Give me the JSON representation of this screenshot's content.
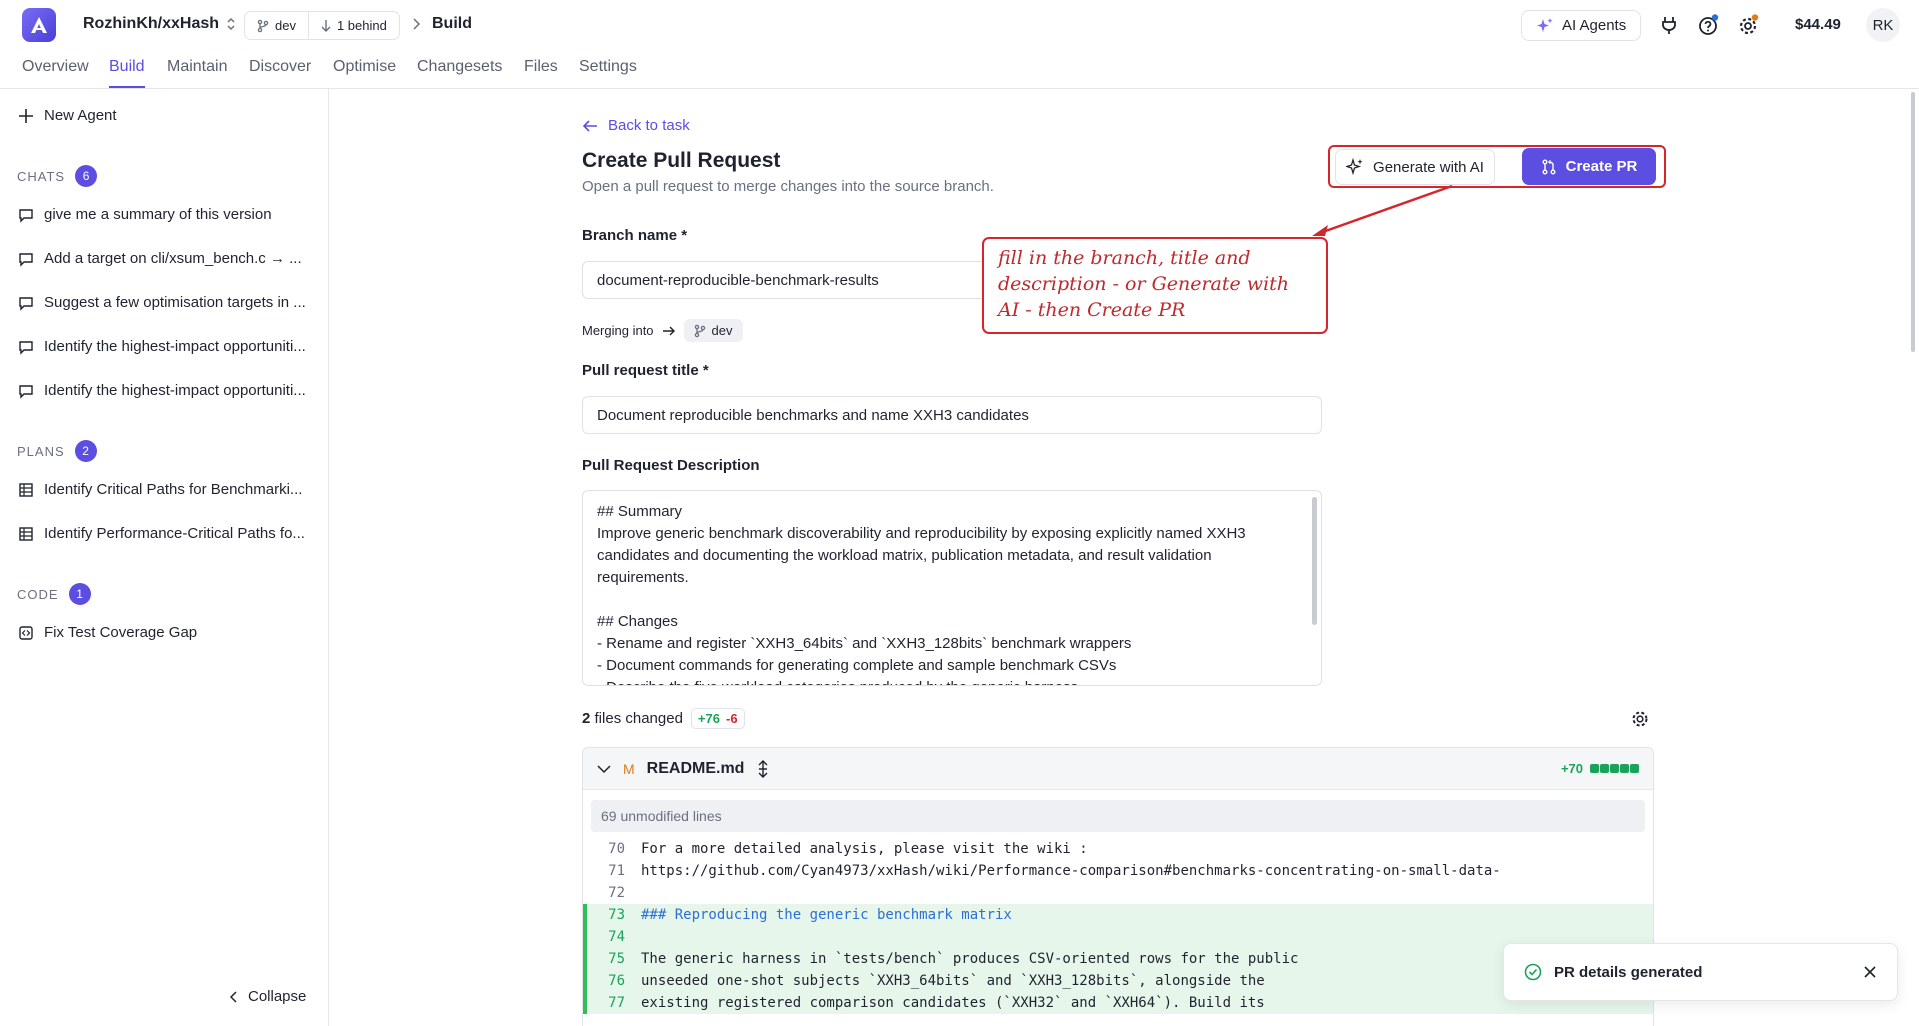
{
  "app": {
    "repo": "RozhinKh/xxHash",
    "branch": "dev",
    "behind": "1 behind",
    "crumb": "Build"
  },
  "top": {
    "ai_agents": "AI Agents",
    "balance": "$44.49",
    "avatar": "RK"
  },
  "nav": {
    "tabs": [
      "Overview",
      "Build",
      "Maintain",
      "Discover",
      "Optimise",
      "Changesets",
      "Files",
      "Settings"
    ],
    "active": "Build"
  },
  "sidebar": {
    "new_agent": "New Agent",
    "chats": {
      "label": "CHATS",
      "count": "6",
      "items": [
        "give me a summary of this version",
        "Add a target on cli/xsum_bench.c → ...",
        "Suggest a few optimisation targets in ...",
        "Identify the highest-impact opportuniti...",
        "Identify the highest-impact opportuniti..."
      ]
    },
    "plans": {
      "label": "PLANS",
      "count": "2",
      "items": [
        "Identify Critical Paths for Benchmarki...",
        "Identify Performance-Critical Paths fo..."
      ]
    },
    "code": {
      "label": "CODE",
      "count": "1",
      "items": [
        "Fix Test Coverage Gap"
      ]
    },
    "collapse": "Collapse"
  },
  "main": {
    "back": "Back to task",
    "title": "Create Pull Request",
    "subtitle": "Open a pull request to merge changes into the source branch.",
    "generate": "Generate with AI",
    "create": "Create PR",
    "branch_label": "Branch name *",
    "branch_value": "document-reproducible-benchmark-results",
    "merging_into": "Merging into",
    "merge_branch": "dev",
    "title_label": "Pull request title *",
    "title_value": "Document reproducible benchmarks and name XXH3 candidates",
    "desc_label": "Pull Request Description",
    "desc_lines": [
      "## Summary",
      "Improve generic benchmark discoverability and reproducibility by exposing explicitly named XXH3",
      "candidates and documenting the workload matrix, publication metadata, and result validation",
      "requirements.",
      "",
      "## Changes",
      "- Rename and register `XXH3_64bits` and `XXH3_128bits` benchmark wrappers",
      "- Document commands for generating complete and sample benchmark CSVs",
      "- Describe the five workload categories produced by the generic harness"
    ],
    "note_lines": [
      "fill in the branch, title and",
      "description - or Generate with",
      "AI - then Create PR"
    ],
    "files_count": "2",
    "files_text": "files changed",
    "additions": "+76",
    "deletions": "-6",
    "diff": {
      "status": "M",
      "file": "README.md",
      "plus": "+70",
      "unmodified": "69 unmodified lines",
      "lines": [
        {
          "no": "70",
          "text": "For a more detailed analysis, please visit the wiki :",
          "added": false
        },
        {
          "no": "71",
          "text": "https://github.com/Cyan4973/xxHash/wiki/Performance-comparison#benchmarks-concentrating-on-small-data-",
          "added": false
        },
        {
          "no": "72",
          "text": "",
          "added": false
        },
        {
          "no": "73",
          "text": "### Reproducing the generic benchmark matrix",
          "added": true
        },
        {
          "no": "74",
          "text": "",
          "added": true
        },
        {
          "no": "75",
          "text": "The generic harness in `tests/bench` produces CSV-oriented rows for the public",
          "added": true
        },
        {
          "no": "76",
          "text": "unseeded one-shot subjects `XXH3_64bits` and `XXH3_128bits`, alongside the",
          "added": true
        },
        {
          "no": "77",
          "text": "existing registered comparison candidates (`XXH32` and `XXH64`). Build its",
          "added": true
        }
      ]
    }
  },
  "toast": {
    "text": "PR details generated"
  }
}
